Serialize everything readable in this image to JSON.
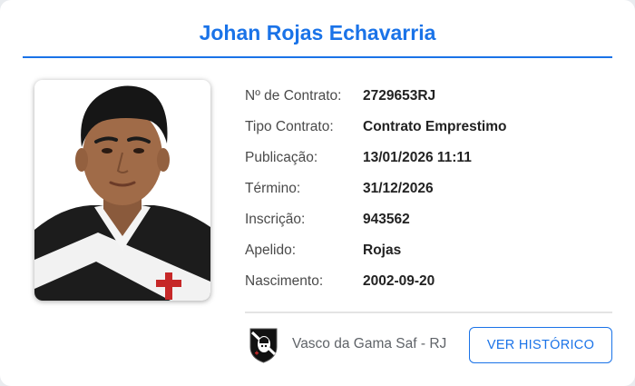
{
  "player": {
    "name": "Johan Rojas Echavarria"
  },
  "details": [
    {
      "label": "Nº de Contrato:",
      "value": "2729653RJ"
    },
    {
      "label": "Tipo Contrato:",
      "value": "Contrato Emprestimo"
    },
    {
      "label": "Publicação:",
      "value": "13/01/2026 11:11"
    },
    {
      "label": "Término:",
      "value": "31/12/2026"
    },
    {
      "label": "Inscrição:",
      "value": "943562"
    },
    {
      "label": "Apelido:",
      "value": "Rojas"
    },
    {
      "label": "Nascimento:",
      "value": "2002-09-20"
    }
  ],
  "club": {
    "name": "Vasco da Gama Saf - RJ",
    "crest_icon": "vasco-crest-icon"
  },
  "actions": {
    "history_label": "VER HISTÓRICO"
  },
  "colors": {
    "accent": "#1a73e8",
    "label_text": "#4a4a4a",
    "value_text": "#222222"
  }
}
